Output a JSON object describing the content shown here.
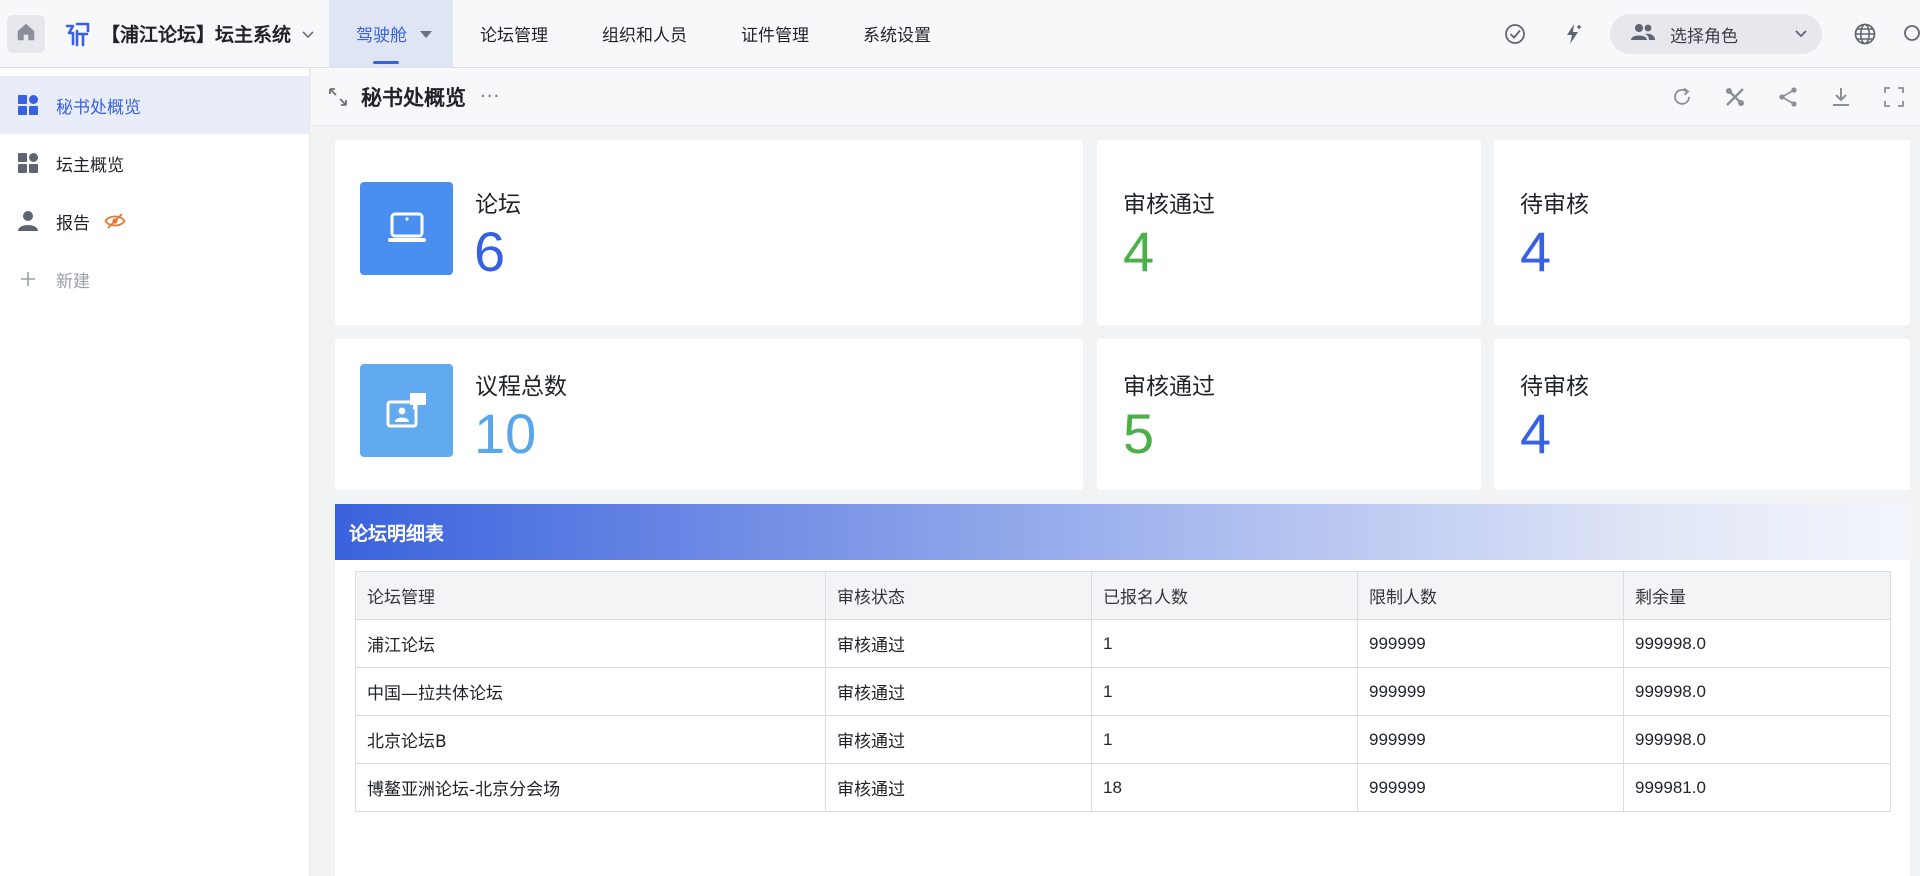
{
  "app": {
    "title": "【浦江论坛】坛主系统"
  },
  "nav": {
    "items": [
      {
        "label": "驾驶舱"
      },
      {
        "label": "论坛管理"
      },
      {
        "label": "组织和人员"
      },
      {
        "label": "证件管理"
      },
      {
        "label": "系统设置"
      }
    ],
    "role_placeholder": "选择角色"
  },
  "sidebar": {
    "items": [
      {
        "label": "秘书处概览"
      },
      {
        "label": "坛主概览"
      },
      {
        "label": "报告"
      },
      {
        "label": "新建"
      }
    ]
  },
  "page": {
    "title": "秘书处概览",
    "more": "···"
  },
  "stats": {
    "forum": {
      "label": "论坛",
      "value": "6"
    },
    "forum_approved": {
      "label": "审核通过",
      "value": "4"
    },
    "forum_pending": {
      "label": "待审核",
      "value": "4"
    },
    "agenda": {
      "label": "议程总数",
      "value": "10"
    },
    "agenda_approved": {
      "label": "审核通过",
      "value": "5"
    },
    "agenda_pending": {
      "label": "待审核",
      "value": "4"
    }
  },
  "colors": {
    "accent": "#3761e0",
    "approved": "#4cb04a",
    "pending": "#3761e0",
    "forum_value": "#3761e0",
    "agenda_value": "#5aa6ea"
  },
  "table": {
    "title": "论坛明细表",
    "columns": [
      "论坛管理",
      "审核状态",
      "已报名人数",
      "限制人数",
      "剩余量"
    ],
    "rows": [
      [
        "浦江论坛",
        "审核通过",
        "1",
        "999999",
        "999998.0"
      ],
      [
        "中国—拉共体论坛",
        "审核通过",
        "1",
        "999999",
        "999998.0"
      ],
      [
        "北京论坛B",
        "审核通过",
        "1",
        "999999",
        "999998.0"
      ],
      [
        "博鳌亚洲论坛-北京分会场",
        "审核通过",
        "18",
        "999999",
        "999981.0"
      ]
    ]
  }
}
